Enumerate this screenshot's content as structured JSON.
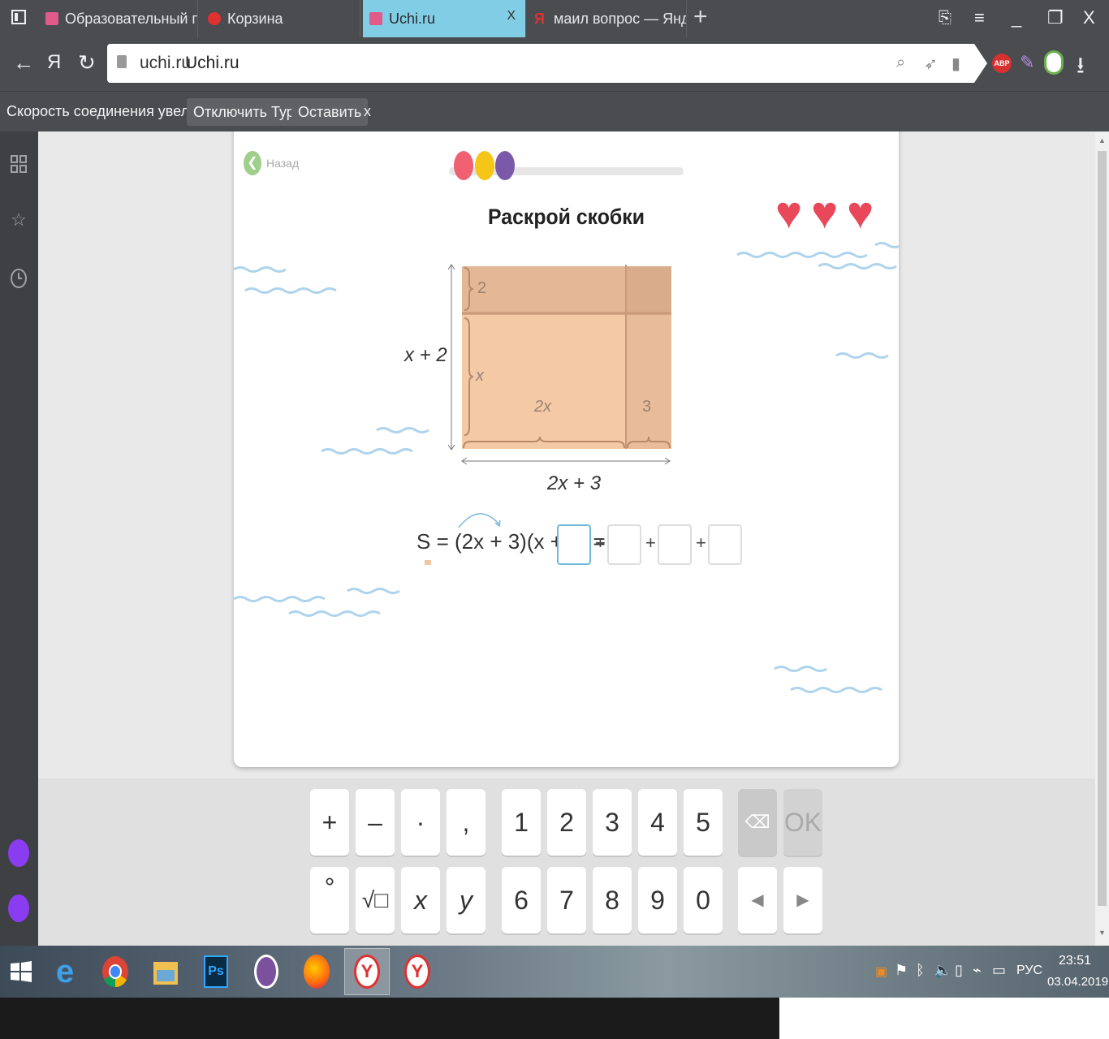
{
  "browser": {
    "tabs": [
      {
        "label": "Образовательный портал",
        "color": "#e05a8a"
      },
      {
        "label": "Корзина",
        "color": "#e03030"
      },
      {
        "label": "Uchi.ru",
        "color": "#e05a8a",
        "close": "X"
      },
      {
        "label": "маил вопрос — Яндекс: на",
        "color": "#e03030"
      }
    ],
    "new_tab": "+",
    "window_controls": {
      "minimize": "_",
      "restore": "❐",
      "close": "X"
    }
  },
  "address": {
    "domain": "uchi.ru",
    "title": "Uchi.ru",
    "back": "←",
    "yandex": "Я",
    "reload": "↻"
  },
  "infobar": {
    "message": "Скорость соединения увеличилась.",
    "disable_turbo": "Отключить Турбо",
    "keep": "Оставить",
    "close": "x"
  },
  "lesson": {
    "back_label": "Назад",
    "title": "Раскрой скобки",
    "progress_dots": [
      "#f06070",
      "#f5c518",
      "#7a5aa8"
    ],
    "lives": 3,
    "figure": {
      "side_label": "x + 2",
      "bottom_label": "2x + 3",
      "top_strip": "2",
      "left_part": "x",
      "bottom_left": "2x",
      "bottom_right": "3"
    },
    "equation": "S = (2x + 3)(x + 2)  =",
    "plus": "+"
  },
  "keyboard": {
    "row1": [
      "+",
      "–",
      "·",
      ",",
      "1",
      "2",
      "3",
      "4",
      "5"
    ],
    "row2": [
      "°",
      "√□",
      "x",
      "y",
      "6",
      "7",
      "8",
      "9",
      "0"
    ],
    "backspace": "⌫",
    "ok": "OK",
    "left": "◀",
    "right": "▶"
  },
  "taskbar": {
    "lang": "РУС",
    "time": "23:51",
    "date": "03.04.2019"
  }
}
